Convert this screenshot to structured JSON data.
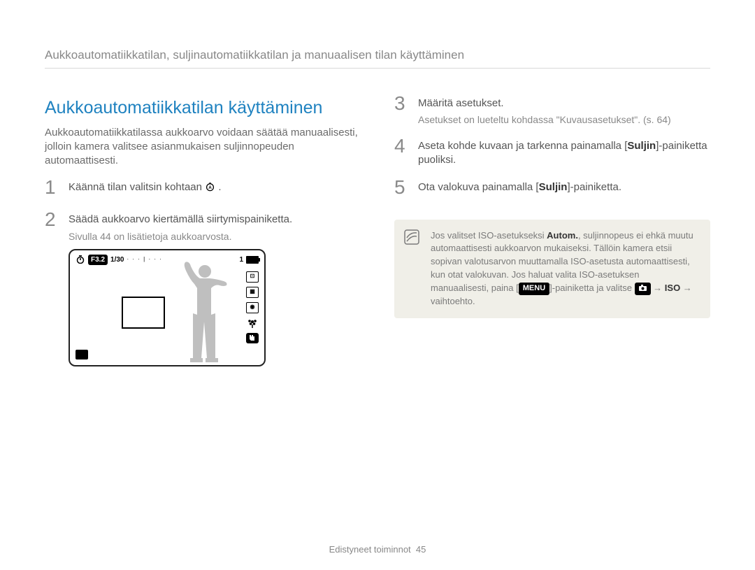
{
  "running_title": "Aukkoautomatiikkatilan, suljinautomatiikkatilan ja manuaalisen tilan käyttäminen",
  "left": {
    "heading": "Aukkoautomatiikkatilan käyttäminen",
    "intro": "Aukkoautomatiikkatilassa aukkoarvo voidaan säätää manuaalisesti, jolloin kamera valitsee asianmukaisen suljinnopeuden automaattisesti.",
    "step1": {
      "num": "1",
      "text_before": "Käännä tilan valitsin kohtaan ",
      "dial_label": "A",
      "text_after": "."
    },
    "step2": {
      "num": "2",
      "text": "Säädä aukkoarvo kiertämällä siirtymispainiketta.",
      "sub": "Sivulla 44 on lisätietoja aukkoarvosta."
    },
    "lcd": {
      "aperture": "F3.2",
      "shutter": "1/30",
      "ev_scale": "· · · | · · ·",
      "shots_remaining": "1"
    }
  },
  "right": {
    "step3": {
      "num": "3",
      "text": "Määritä asetukset.",
      "sub": "Asetukset on lueteltu kohdassa \"Kuvausasetukset\". (s. 64)"
    },
    "step4": {
      "num": "4",
      "text_before": "Aseta kohde kuvaan ja tarkenna painamalla [",
      "bold": "Suljin",
      "text_after": "]-painiketta puoliksi."
    },
    "step5": {
      "num": "5",
      "text_before": "Ota valokuva painamalla [",
      "bold": "Suljin",
      "text_after": "]-painiketta."
    },
    "note": {
      "line1_before": "Jos valitset ISO-asetukseksi ",
      "line1_bold": "Autom.",
      "line1_after": ", suljinnopeus ei ehkä muutu automaattisesti aukkoarvon mukaiseksi. Tällöin kamera etsii sopivan valotusarvon muuttamalla ISO-asetusta automaattisesti, kun otat valokuvan. Jos haluat valita ISO-asetuksen manuaalisesti, paina [",
      "menu_chip": "MENU",
      "line2_after": "]-painiketta ja valitse ",
      "camera_chip": "📷",
      "arrow1": " → ",
      "iso_bold": "ISO",
      "arrow2": " → vaihtoehto."
    }
  },
  "footer": {
    "section": "Edistyneet toiminnot",
    "page": "45"
  }
}
